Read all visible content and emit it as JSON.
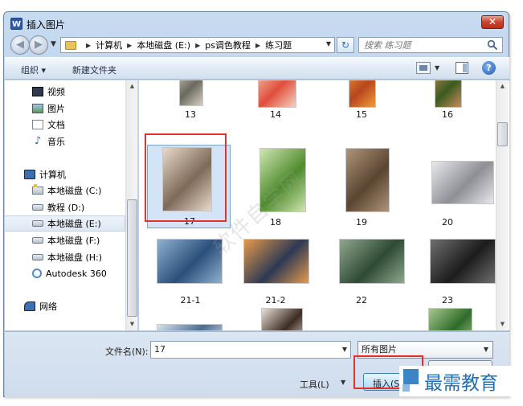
{
  "window": {
    "title": "插入图片",
    "app_icon": "W",
    "close_glyph": "✕"
  },
  "address": {
    "crumbs": [
      "计算机",
      "本地磁盘 (E:)",
      "ps调色教程",
      "练习题"
    ],
    "search_placeholder": "搜索 练习题"
  },
  "toolbar": {
    "organize": "组织 ▾",
    "new_folder": "新建文件夹",
    "help": "?"
  },
  "nav": {
    "libraries": [
      {
        "label": "视频",
        "icon": "video-icon"
      },
      {
        "label": "图片",
        "icon": "pictures-icon"
      },
      {
        "label": "文档",
        "icon": "documents-icon"
      },
      {
        "label": "音乐",
        "icon": "music-icon"
      }
    ],
    "computer": "计算机",
    "drives": [
      {
        "label": "本地磁盘 (C:)",
        "icon": "system-drive-icon"
      },
      {
        "label": "教程 (D:)",
        "icon": "drive-icon"
      },
      {
        "label": "本地磁盘 (E:)",
        "icon": "drive-icon",
        "selected": true
      },
      {
        "label": "本地磁盘 (F:)",
        "icon": "drive-icon"
      },
      {
        "label": "本地磁盘 (H:)",
        "icon": "drive-icon"
      },
      {
        "label": "Autodesk 360",
        "icon": "cloud-icon"
      }
    ],
    "network": "网络"
  },
  "files": [
    {
      "label": "13",
      "colors": [
        "#6b6a5e",
        "#d6cfc2"
      ]
    },
    {
      "label": "14",
      "colors": [
        "#e04e3b",
        "#f4d2c0"
      ]
    },
    {
      "label": "15",
      "colors": [
        "#b8461e",
        "#f09c3a"
      ]
    },
    {
      "label": "16",
      "colors": [
        "#3a5a20",
        "#c98c5c"
      ]
    },
    {
      "label": "17",
      "colors": [
        "#7d6a58",
        "#e9dacb"
      ],
      "selected": true
    },
    {
      "label": "18",
      "colors": [
        "#4f8b2d",
        "#cfe6b2"
      ]
    },
    {
      "label": "19",
      "colors": [
        "#5a4532",
        "#b09478"
      ]
    },
    {
      "label": "20",
      "colors": [
        "#8d8f95",
        "#e7e9ee"
      ]
    },
    {
      "label": "21-1",
      "colors": [
        "#2a4f7a",
        "#8fb1d0"
      ]
    },
    {
      "label": "21-2",
      "colors": [
        "#2d3a54",
        "#e59a4c"
      ]
    },
    {
      "label": "22",
      "colors": [
        "#2e4a35",
        "#8fa78d"
      ]
    },
    {
      "label": "23",
      "colors": [
        "#1c1c1c",
        "#6f6f6f"
      ]
    },
    {
      "label": "",
      "colors": [
        "#4c6c8d",
        "#d8e3ee"
      ]
    },
    {
      "label": "",
      "colors": [
        "#3c2c22",
        "#e9e1d8"
      ]
    },
    {
      "label": "",
      "colors": [
        "#6f9ad1",
        "#f3f7fb"
      ]
    },
    {
      "label": "",
      "colors": [
        "#2f6b2a",
        "#a9c88f"
      ]
    }
  ],
  "bottom": {
    "filename_label": "文件名(N):",
    "filename_value": "17",
    "filter": "所有图片",
    "tools": "工具(L)",
    "insert": "插入(S)",
    "cancel": ""
  },
  "watermark": {
    "brand": "最需教育",
    "diagonal": "软件自学网"
  }
}
